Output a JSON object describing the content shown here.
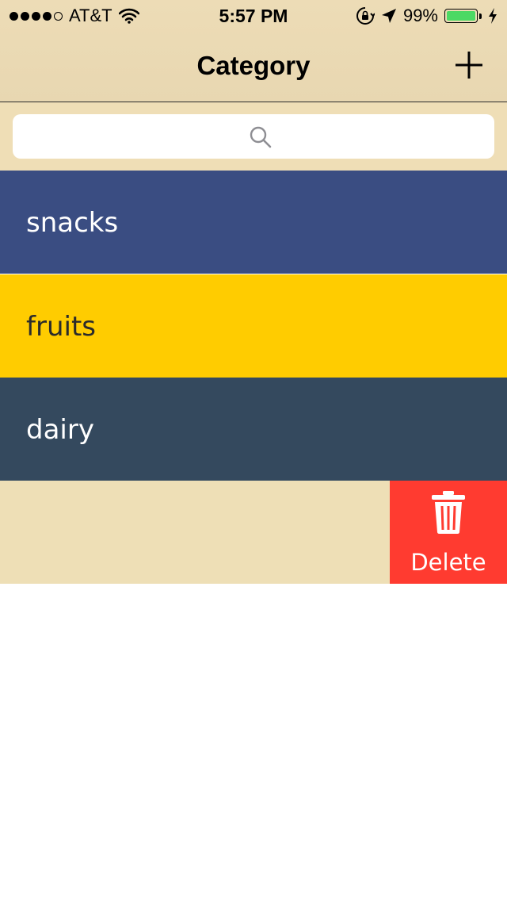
{
  "status_bar": {
    "carrier": "AT&T",
    "time": "5:57 PM",
    "battery_percent": "99%",
    "battery_level": 0.99,
    "signal_bars": 4,
    "signal_total": 5
  },
  "nav": {
    "title": "Category",
    "add_icon": "plus-icon"
  },
  "search": {
    "placeholder": "",
    "icon": "search-icon"
  },
  "categories": [
    {
      "label": "snacks",
      "color": "#3a4d82",
      "text_color": "#ffffff"
    },
    {
      "label": "fruits",
      "color": "#ffcc00",
      "text_color": "#2b2b2b"
    },
    {
      "label": "dairy",
      "color": "#34495e",
      "text_color": "#ffffff"
    }
  ],
  "swipe_action": {
    "label": "Delete",
    "icon": "trash-icon",
    "color": "#ff3b30"
  },
  "colors": {
    "nav_background": "#eddcb6",
    "empty_row_background": "#eedfb6"
  }
}
